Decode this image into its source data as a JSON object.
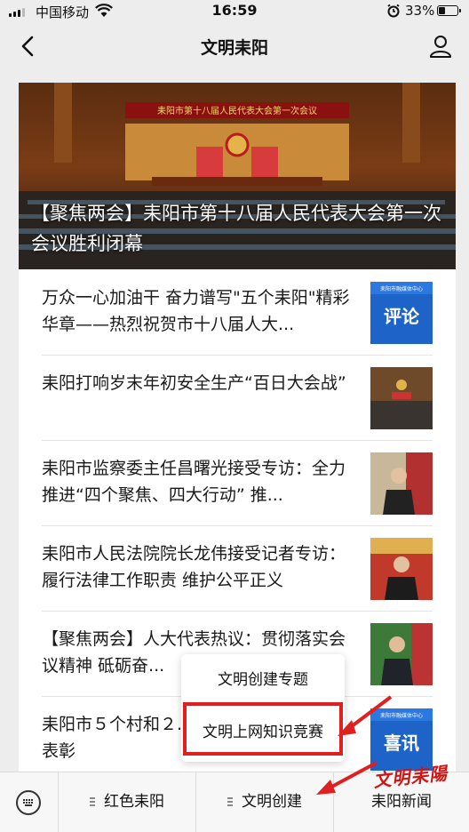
{
  "status_bar": {
    "carrier": "中国移动",
    "time": "16:59",
    "battery": "33%",
    "battery_level": 0.33
  },
  "nav": {
    "title": "文明耒阳"
  },
  "hero": {
    "banner_text": "耒阳市第十八届人民代表大会第一次会议",
    "caption": "【聚焦两会】耒阳市第十八届人民代表大会第一次会议胜利闭幕"
  },
  "articles": [
    {
      "title": "万众一心加油干 奋力谱写\"五个耒阳\"精彩华章——热烈祝贺市十八届人大...",
      "thumb_label": "评论",
      "thumb_sub": "耒阳市融媒体中心"
    },
    {
      "title": "耒阳打响岁末年初安全生产“百日大会战”"
    },
    {
      "title": "耒阳市监察委主任昌曙光接受专访：全力推进“四个聚焦、四大行动” 推..."
    },
    {
      "title": "耒阳市人民法院院长龙伟接受记者专访：履行法律工作职责 维护公平正义"
    },
    {
      "title": "【聚焦两会】人大代表热议：贯彻落实会议精神 砥砺奋..."
    },
    {
      "title": "耒阳市５个村和２...年村庄清洁行动先进表彰",
      "thumb_label": "喜讯",
      "thumb_sub": "耒阳市融媒体中心"
    }
  ],
  "popup": {
    "items": [
      "文明创建专题",
      "文明上网知识竞赛"
    ]
  },
  "menu": {
    "items": [
      "红色耒阳",
      "文明创建",
      "耒阳新闻"
    ]
  },
  "watermark": "文明耒陽",
  "colors": {
    "highlight": "#e02020"
  }
}
